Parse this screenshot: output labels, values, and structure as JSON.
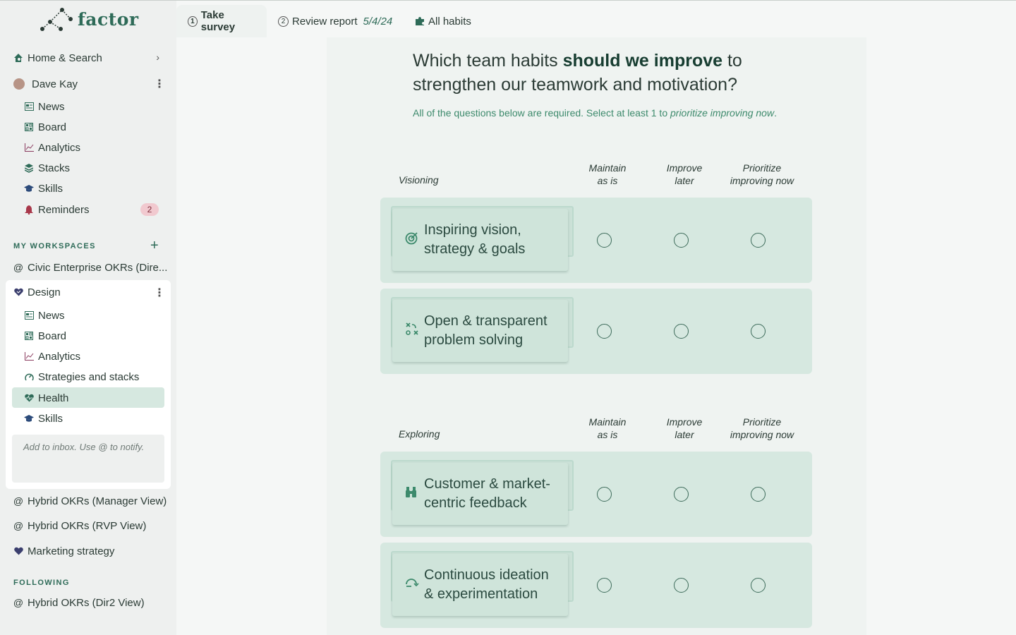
{
  "app": {
    "brand": "factor",
    "accent": "#2e6b58"
  },
  "sidebar": {
    "home": "Home & Search",
    "user": "Dave Kay",
    "user_items": [
      {
        "label": "News",
        "icon": "news-icon"
      },
      {
        "label": "Board",
        "icon": "board-icon"
      },
      {
        "label": "Analytics",
        "icon": "analytics-icon"
      },
      {
        "label": "Stacks",
        "icon": "stacks-icon"
      },
      {
        "label": "Skills",
        "icon": "skills-icon"
      },
      {
        "label": "Reminders",
        "icon": "bell-icon",
        "badge": "2"
      }
    ],
    "workspaces_label": "MY WORKSPACES",
    "workspace_civic": "Civic Enterprise OKRs (Dire...",
    "design": {
      "title": "Design",
      "items": [
        {
          "label": "News",
          "icon": "news-icon"
        },
        {
          "label": "Board",
          "icon": "board-icon"
        },
        {
          "label": "Analytics",
          "icon": "analytics-icon"
        },
        {
          "label": "Strategies and stacks",
          "icon": "gauge-icon"
        },
        {
          "label": "Health",
          "icon": "heart-pulse-icon",
          "active": true
        },
        {
          "label": "Skills",
          "icon": "skills-icon"
        }
      ],
      "inbox_placeholder": "Add to inbox. Use @ to notify."
    },
    "workspaces_more": [
      "Hybrid OKRs (Manager View)",
      "Hybrid OKRs (RVP View)",
      "Marketing strategy"
    ],
    "following_label": "FOLLOWING",
    "following": [
      "Hybrid OKRs (Dir2 View)"
    ]
  },
  "tabs": [
    {
      "num": "1",
      "label": "Take survey",
      "active": true
    },
    {
      "num": "2",
      "label": "Review report",
      "date": "5/4/24"
    },
    {
      "label": "All habits",
      "icon": "puzzle-icon"
    }
  ],
  "survey": {
    "question_pre": "Which team habits ",
    "question_bold": "should we improve",
    "question_post": " to strengthen our teamwork and motivation?",
    "instructions_pre": "All of the questions below are required. Select at least 1 to ",
    "instructions_em": "prioritize improving now",
    "instructions_post": ".",
    "columns": [
      {
        "line1": "Maintain",
        "line2": "as is"
      },
      {
        "line1": "Improve",
        "line2": "later"
      },
      {
        "line1": "Prioritize",
        "line2": "improving now"
      }
    ],
    "groups": [
      {
        "label": "Visioning",
        "habits": [
          {
            "line1": "Inspiring vision,",
            "line2": "strategy & goals",
            "icon": "target-icon"
          },
          {
            "line1": "Open & transparent",
            "line2": "problem solving",
            "icon": "strategy-icon"
          }
        ]
      },
      {
        "label": "Exploring",
        "habits": [
          {
            "line1": "Customer & market-",
            "line2": "centric feedback",
            "icon": "binoculars-icon"
          },
          {
            "line1": "Continuous ideation",
            "line2": "& experimentation",
            "icon": "cycle-icon"
          }
        ]
      }
    ]
  }
}
